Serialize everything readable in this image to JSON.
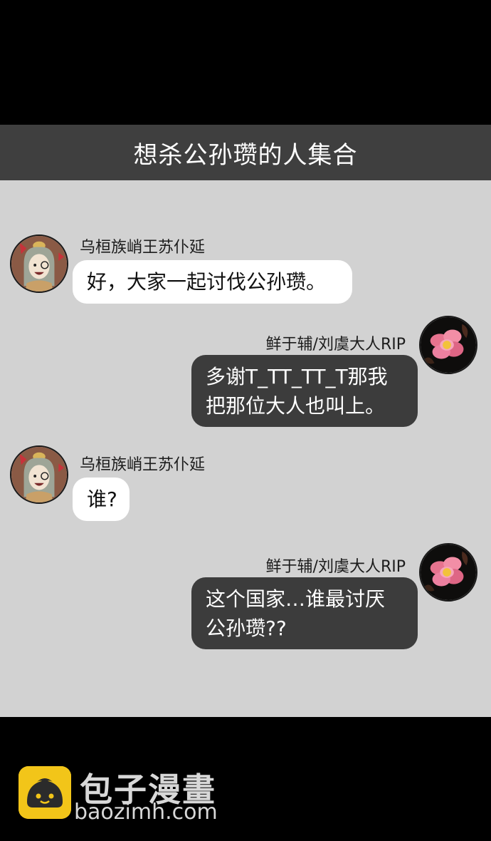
{
  "header": {
    "title": "想杀公孙瓒的人集合"
  },
  "messages": [
    {
      "sender": "乌桓族峭王苏仆延",
      "text": "好，大家一起讨伐公孙瓒。"
    },
    {
      "sender": "鲜于辅/刘虞大人RIP",
      "text": "多谢T_TT_TT_T那我把那位大人也叫上。"
    },
    {
      "sender": "乌桓族峭王苏仆延",
      "text": "谁?"
    },
    {
      "sender": "鲜于辅/刘虞大人RIP",
      "text": "这个国家…谁最讨厌公孙瓒??"
    }
  ],
  "watermark": {
    "name": "包子漫畫",
    "url": "baozimh.com"
  },
  "colors": {
    "title_bar": "#3f3f3f",
    "chat_bg": "#d2d2d2",
    "left_bubble": "#ffffff",
    "right_bubble": "#3c3c3c",
    "logo_yellow": "#f2c519"
  },
  "icons": {
    "left_avatar": "cartoon-character-avatar",
    "right_avatar": "pink-flower-avatar",
    "logo": "baozi-bun-icon"
  }
}
